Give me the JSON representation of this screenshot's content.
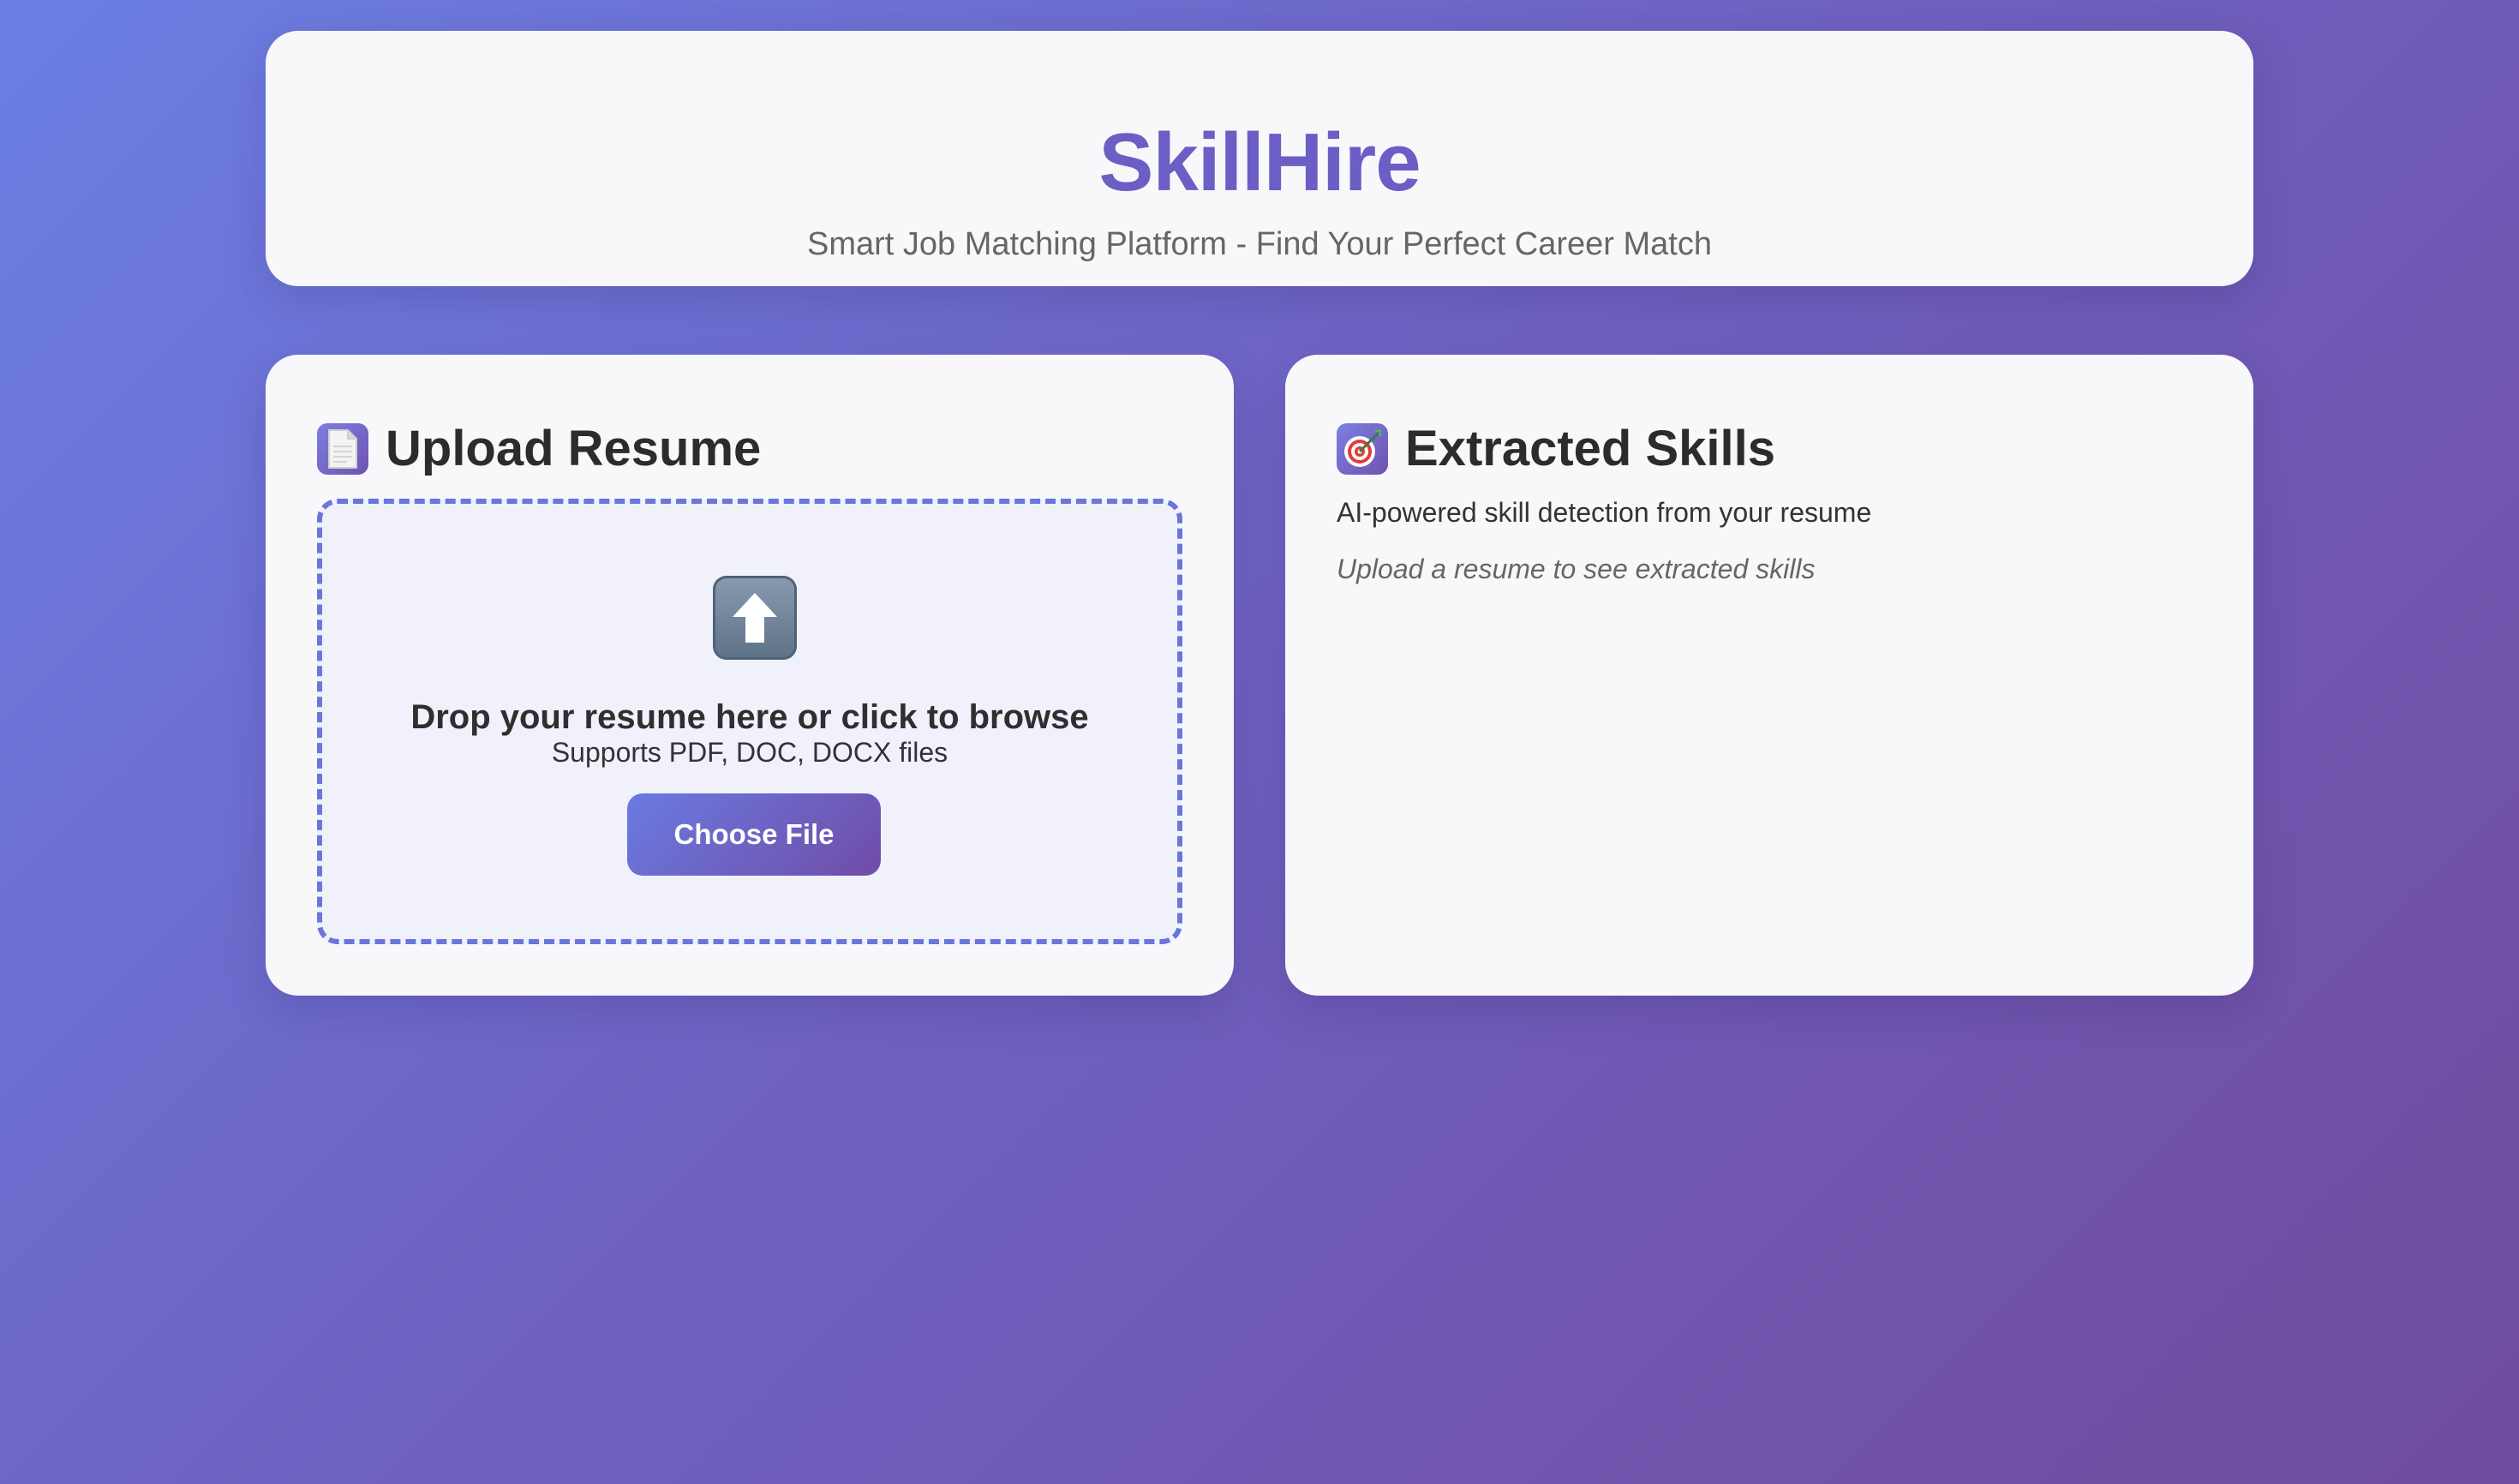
{
  "header": {
    "title": "SkillHire",
    "subtitle": "Smart Job Matching Platform - Find Your Perfect Career Match"
  },
  "upload_panel": {
    "icon": "document-icon",
    "heading": "Upload Resume",
    "dropzone": {
      "icon": "up-arrow-icon",
      "title": "Drop your resume here or click to browse",
      "hint": "Supports PDF, DOC, DOCX files",
      "button_label": "Choose File"
    }
  },
  "skills_panel": {
    "icon": "target-icon",
    "heading": "Extracted Skills",
    "description": "AI-powered skill detection from your resume",
    "empty_state": "Upload a resume to see extracted skills"
  },
  "colors": {
    "brand": "#6b5ec4",
    "accent": "#6b76db",
    "background_start": "#6b7fe3",
    "background_end": "#704c9e"
  }
}
